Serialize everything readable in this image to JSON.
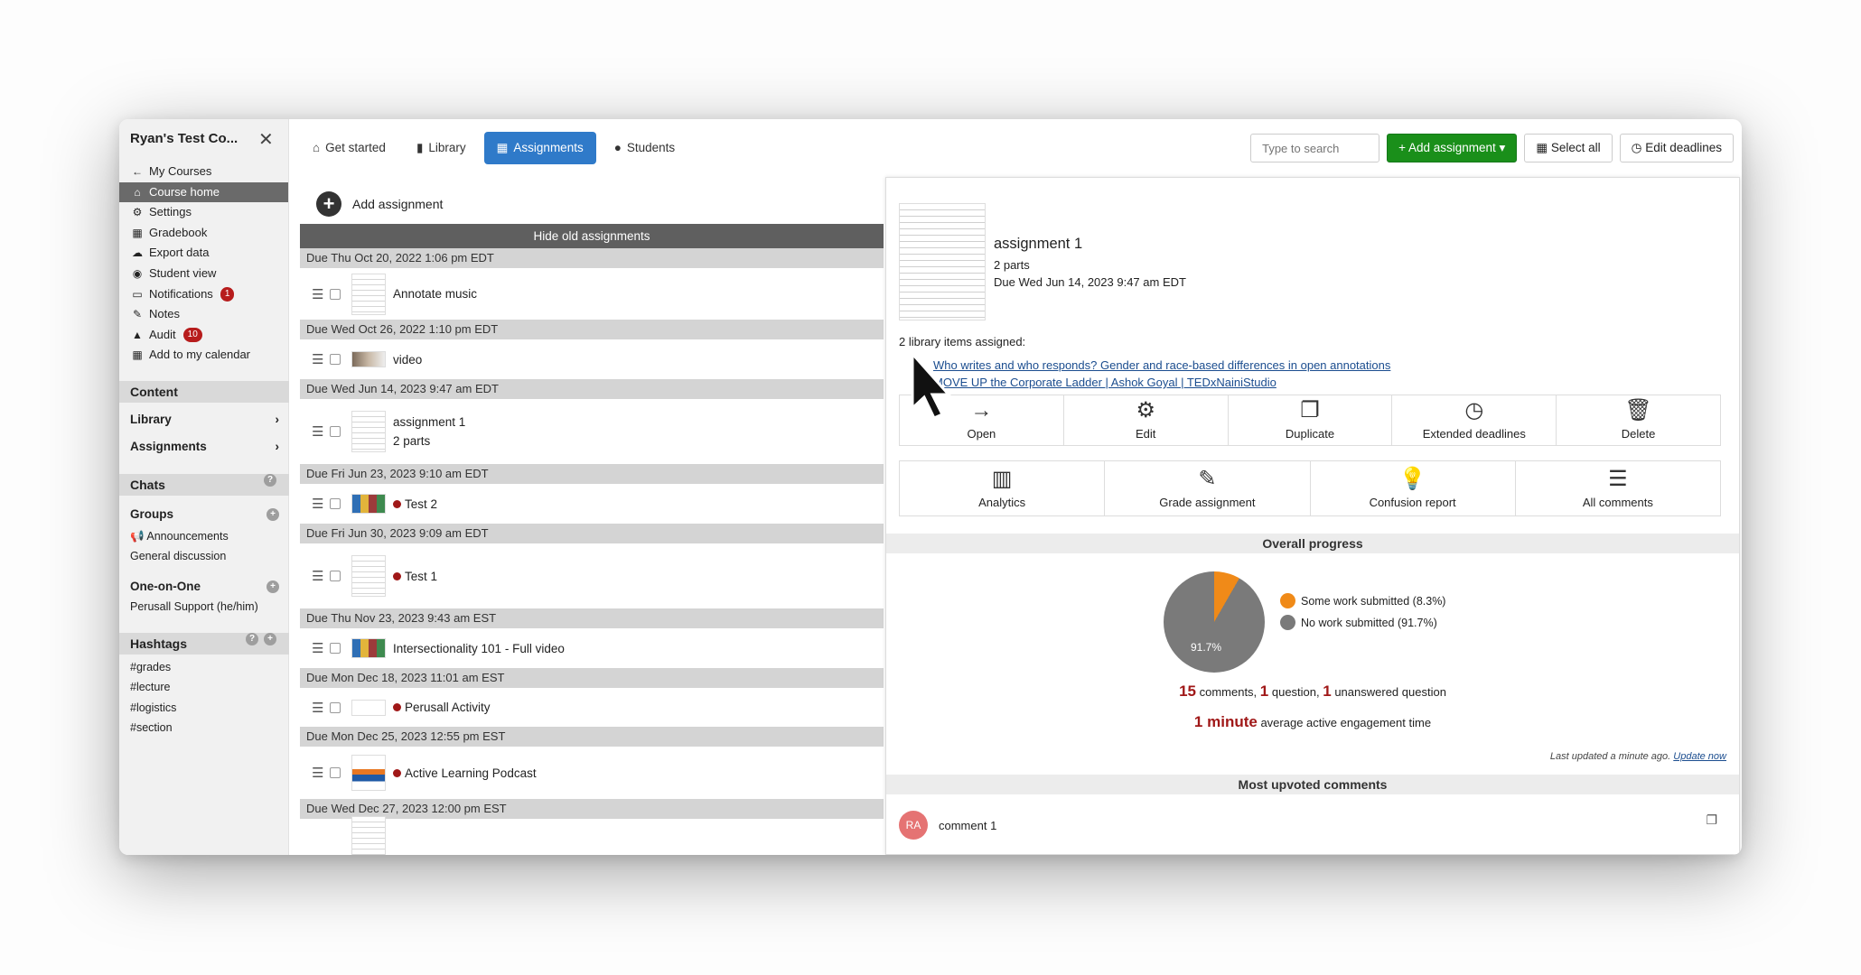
{
  "sidebar": {
    "course_title": "Ryan's Test Co...",
    "links": [
      {
        "icon": "←",
        "label": "My Courses"
      },
      {
        "icon": "⌂",
        "label": "Course home",
        "active": true
      },
      {
        "icon": "⚙",
        "label": "Settings"
      },
      {
        "icon": "▦",
        "label": "Gradebook"
      },
      {
        "icon": "☁",
        "label": "Export data"
      },
      {
        "icon": "◉",
        "label": "Student view"
      },
      {
        "icon": "▭",
        "label": "Notifications",
        "badge": "1"
      },
      {
        "icon": "✎",
        "label": "Notes"
      },
      {
        "icon": "▲",
        "label": "Audit",
        "badge": "10"
      },
      {
        "icon": "▦",
        "label": "Add to my calendar"
      }
    ],
    "content_header": "Content",
    "library_label": "Library",
    "assignments_label": "Assignments",
    "chats_header": "Chats",
    "groups_label": "Groups",
    "announcements_label": "Announcements",
    "general_discussion_label": "General discussion",
    "one_on_one_label": "One-on-One",
    "support_label": "Perusall Support (he/him)",
    "hashtags_header": "Hashtags",
    "hashtags": [
      "#grades",
      "#lecture",
      "#logistics",
      "#section"
    ]
  },
  "nav": {
    "tabs": [
      "Get started",
      "Library",
      "Assignments",
      "Students"
    ],
    "search_placeholder": "Type to search",
    "add_assignment": "+ Add assignment ▾",
    "select_all": "Select all",
    "edit_deadlines": "Edit deadlines"
  },
  "list": {
    "add_assignment": "Add assignment",
    "hide_old": "Hide old assignments",
    "groups": [
      {
        "due": "Due Thu Oct 20, 2022 1:06 pm EDT",
        "title": "Annotate music",
        "sub": "",
        "dot": false,
        "thumb": "doc"
      },
      {
        "due": "Due Wed Oct 26, 2022 1:10 pm EDT",
        "title": "video",
        "sub": "",
        "dot": false,
        "thumb": "small"
      },
      {
        "due": "Due Wed Jun 14, 2023 9:47 am EDT",
        "title": "assignment 1",
        "sub": "2 parts",
        "dot": false,
        "thumb": "doc"
      },
      {
        "due": "Due Fri Jun 23, 2023 9:10 am EDT",
        "title": "Test 2",
        "sub": "",
        "dot": true,
        "thumb": "colorful"
      },
      {
        "due": "Due Fri Jun 30, 2023 9:09 am EDT",
        "title": "Test 1",
        "sub": "",
        "dot": true,
        "thumb": "doc"
      },
      {
        "due": "Due Thu Nov 23, 2023 9:43 am EST",
        "title": "Intersectionality 101 - Full video",
        "sub": "",
        "dot": false,
        "thumb": "colorful"
      },
      {
        "due": "Due Mon Dec 18, 2023 11:01 am EST",
        "title": "Perusall Activity",
        "sub": "",
        "dot": true,
        "thumb": "tiny"
      },
      {
        "due": "Due Mon Dec 25, 2023 12:55 pm EST",
        "title": "Active Learning Podcast",
        "sub": "",
        "dot": true,
        "thumb": "podcast"
      },
      {
        "due": "Due Wed Dec 27, 2023 12:00 pm EST",
        "title": "",
        "sub": "",
        "dot": false,
        "thumb": "doc"
      }
    ]
  },
  "detail": {
    "title": "assignment 1",
    "parts": "2 parts",
    "due": "Due Wed Jun 14, 2023 9:47 am EDT",
    "library_count": "2 library items assigned:",
    "library_items": [
      "Who writes and who responds? Gender and race-based differences in open annotations",
      "MOVE UP the Corporate Ladder | Ashok Goyal | TEDxNainiStudio"
    ],
    "actions_row1": [
      {
        "icon": "arrow-right-icon",
        "glyph": "→",
        "label": "Open"
      },
      {
        "icon": "gear-icon",
        "glyph": "⚙",
        "label": "Edit"
      },
      {
        "icon": "duplicate-icon",
        "glyph": "❐",
        "label": "Duplicate"
      },
      {
        "icon": "clock-icon",
        "glyph": "◷",
        "label": "Extended deadlines"
      },
      {
        "icon": "trash-icon",
        "glyph": "🗑",
        "label": "Delete"
      }
    ],
    "actions_row2": [
      {
        "icon": "bar-chart-icon",
        "glyph": "▥",
        "label": "Analytics"
      },
      {
        "icon": "edit-square-icon",
        "glyph": "✎",
        "label": "Grade assignment"
      },
      {
        "icon": "lightbulb-icon",
        "glyph": "💡",
        "label": "Confusion report"
      },
      {
        "icon": "list-icon",
        "glyph": "☰",
        "label": "All comments"
      }
    ],
    "progress_header": "Overall progress",
    "legend": [
      {
        "label": "Some work submitted (8.3%)",
        "color": "#f08a18"
      },
      {
        "label": "No work submitted (91.7%)",
        "color": "#7a7a7a"
      }
    ],
    "pie_label": "91.7%",
    "comments_count": "15",
    "comments_text": " comments, ",
    "question_count": "1",
    "question_text": " question, ",
    "unanswered_count": "1",
    "unanswered_text": " unanswered question",
    "engagement_value": "1 minute",
    "engagement_text": " average active engagement time",
    "last_updated": "Last updated a minute ago. ",
    "update_now": "Update now",
    "upvoted_header": "Most upvoted comments",
    "comment_avatar": "RA",
    "comment_text": "comment 1"
  },
  "chart_data": {
    "type": "pie",
    "categories": [
      "Some work submitted",
      "No work submitted"
    ],
    "values": [
      8.3,
      91.7
    ],
    "colors": [
      "#f08a18",
      "#7a7a7a"
    ],
    "legend": "right"
  }
}
